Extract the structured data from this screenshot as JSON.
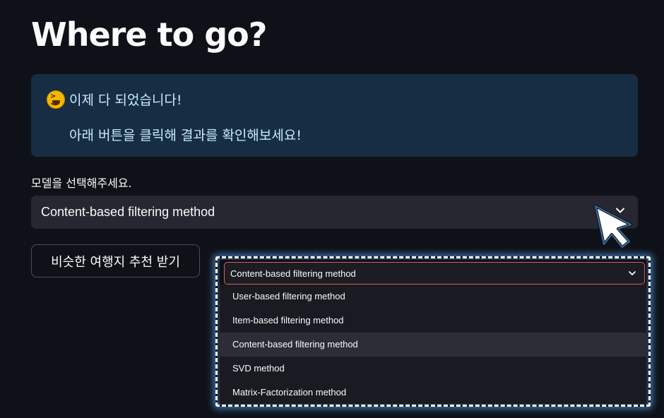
{
  "page": {
    "title": "Where to go?"
  },
  "info": {
    "emoji": "laughing-face-emoji",
    "line1": "이제 다 되었습니다!",
    "line2": "아래 버튼을 클릭해 결과를 확인해보세요!"
  },
  "model_select": {
    "label": "모델을 선택해주세요.",
    "value": "Content-based filtering method"
  },
  "recommend_button": {
    "label": "비슷한 여행지 추천 받기"
  },
  "dropdown_zoom": {
    "selected": "Content-based filtering method",
    "options": [
      "User-based filtering method",
      "Item-based filtering method",
      "Content-based filtering method",
      "SVD method",
      "Matrix-Factorization method"
    ],
    "highlighted_index": 2
  },
  "icons": {
    "chevron": "chevron-down-icon",
    "cursor": "mouse-pointer-icon"
  },
  "colors": {
    "background": "#0e1117",
    "info_bg": "#172d43",
    "info_text": "#c7ebff",
    "select_bg": "#262730",
    "focus_border": "#e05a4f",
    "highlight_glow": "#5aaaff"
  }
}
